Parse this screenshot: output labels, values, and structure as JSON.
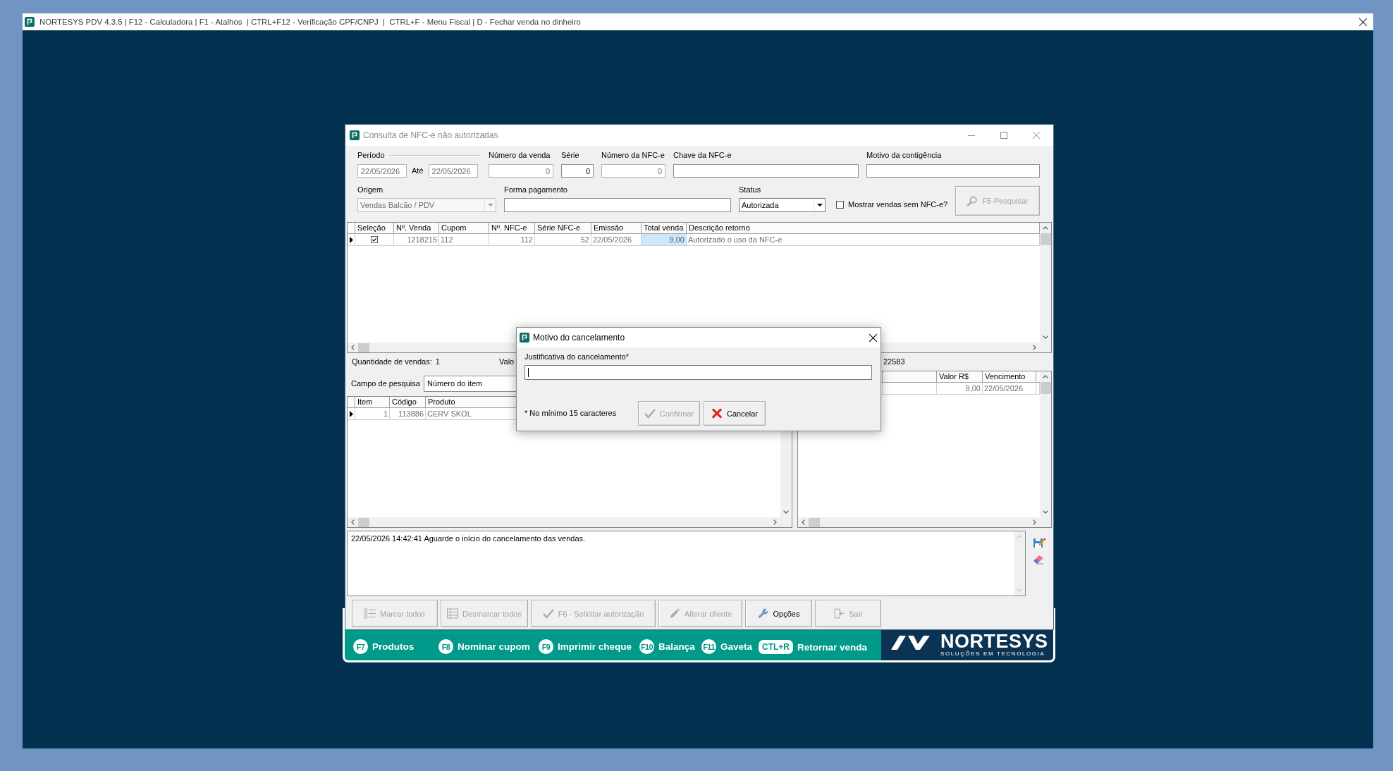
{
  "app_window": {
    "title": "NORTESYS PDV 4.3.5 | F12 - Calculadora | F1 - Atalhos  | CTRL+F12 - Verificação CPF/CNPJ  |  CTRL+F - Menu Fiscal | D - Fechar venda no dinheiro"
  },
  "query_window": {
    "title": "Consulta de NFC-e não autorizadas",
    "active": false,
    "filters": {
      "period": {
        "label": "Período",
        "from": "22/05/2026",
        "to_label": "Até",
        "to": "22/05/2026",
        "disabled": true
      },
      "sale_number": {
        "label": "Número da venda",
        "value": "0",
        "disabled": true
      },
      "series": {
        "label": "Série",
        "value": "0",
        "disabled": false
      },
      "nfce_number": {
        "label": "Número da NFC-e",
        "value": "0",
        "disabled": true
      },
      "nfce_key": {
        "label": "Chave da NFC-e"
      },
      "contingency_reason": {
        "label": "Motivo da contigência"
      },
      "origin": {
        "label": "Origem",
        "value": "Vendas Balcão / PDV",
        "disabled": true
      },
      "payment_method": {
        "label": "Forma pagamento"
      },
      "status": {
        "label": "Status",
        "value": "Autorizada",
        "disabled": false
      },
      "show_without_nfce": {
        "label": "Mostrar vendas sem NFC-e?",
        "checked": false
      },
      "search_button": {
        "label": "F5-Pesquisar",
        "disabled": true
      }
    },
    "sales_table": {
      "columns": [
        {
          "label": "Seleção",
          "kind": "check"
        },
        {
          "label": "Nº. Venda",
          "kind": "number"
        },
        {
          "label": "Cupom",
          "kind": "text"
        },
        {
          "label": "Nº. NFC-e",
          "kind": "number"
        },
        {
          "label": "Série NFC-e",
          "kind": "number"
        },
        {
          "label": "Emissão",
          "kind": "text"
        },
        {
          "label": "Total venda",
          "kind": "number"
        },
        {
          "label": "Descrição retorno",
          "kind": "text"
        }
      ],
      "rows": [
        {
          "selected": true,
          "cells": [
            {
              "checked": true
            },
            {
              "text": "1218215",
              "focused": false
            },
            {
              "text": "112",
              "focused": false
            },
            {
              "text": "112",
              "focused": false
            },
            {
              "text": "52",
              "focused": false
            },
            {
              "text": "22/05/2026",
              "focused": false
            },
            {
              "text": "9,00",
              "focused": true
            },
            {
              "text": "Autorizado o uso da NFC-e",
              "focused": false
            }
          ]
        }
      ]
    },
    "summary": {
      "count_label": "Quantidade de vendas:",
      "count": "1",
      "label_2": "Valo",
      "text_3": "22583"
    },
    "items_search": {
      "label": "Campo de pesquisa",
      "value": "Número do item"
    },
    "items_table": {
      "columns": [
        {
          "label": "Item",
          "kind": "number"
        },
        {
          "label": "Código",
          "kind": "number"
        },
        {
          "label": "Produto",
          "kind": "text"
        }
      ],
      "rows": [
        {
          "selected": true,
          "cells": [
            "1",
            "113886",
            "CERV SKOL"
          ]
        }
      ]
    },
    "payments_table": {
      "columns": [
        {
          "label": "Valor R$",
          "kind": "number"
        },
        {
          "label": "Vencimento",
          "kind": "text"
        }
      ],
      "rows": [
        {
          "cells": [
            "9,00",
            "22/05/2026"
          ]
        }
      ]
    },
    "log": {
      "lines": [
        "22/05/2026 14:42:41 Aguarde o início do cancelamento das vendas."
      ]
    },
    "buttons": [
      {
        "label": "Marcar todos",
        "kind": "mark_all",
        "disabled": true
      },
      {
        "label": "Desmarcar todos",
        "kind": "unmark_all",
        "disabled": true
      },
      {
        "label": "F6 - Solicitar autorização",
        "kind": "request",
        "disabled": true
      },
      {
        "label": "Alterar cliente",
        "kind": "edit",
        "disabled": true
      },
      {
        "label": "Opções",
        "kind": "options",
        "disabled": false
      },
      {
        "label": "Sair",
        "kind": "exit",
        "disabled": true
      }
    ]
  },
  "shortcut_bar": {
    "items": [
      {
        "key": "F7",
        "label": "Produtos",
        "kind": "circle"
      },
      {
        "key": "F8",
        "label": "Nominar cupom",
        "kind": "circle"
      },
      {
        "key": "F9",
        "label": "Imprimir cheque",
        "kind": "circle"
      },
      {
        "key": "F10",
        "label": "Balança",
        "kind": "circle"
      },
      {
        "key": "F11",
        "label": "Gaveta",
        "kind": "circle"
      },
      {
        "key": "CTL+R",
        "label": "Retornar venda",
        "kind": "pill"
      }
    ],
    "brand": {
      "name": "NORTESYS",
      "tagline": "SOLUÇÕES EM TECNOLOGIA"
    }
  },
  "cancel_dialog": {
    "title": "Motivo do cancelamento",
    "active": true,
    "field": {
      "label": "Justificativa do cancelamento*",
      "focused": true
    },
    "note": "* No mínimo 15 caracteres",
    "buttons": [
      {
        "label": "Confirmar",
        "kind": "confirm",
        "disabled": true
      },
      {
        "label": "Cancelar",
        "kind": "cancel",
        "disabled": false
      }
    ]
  }
}
